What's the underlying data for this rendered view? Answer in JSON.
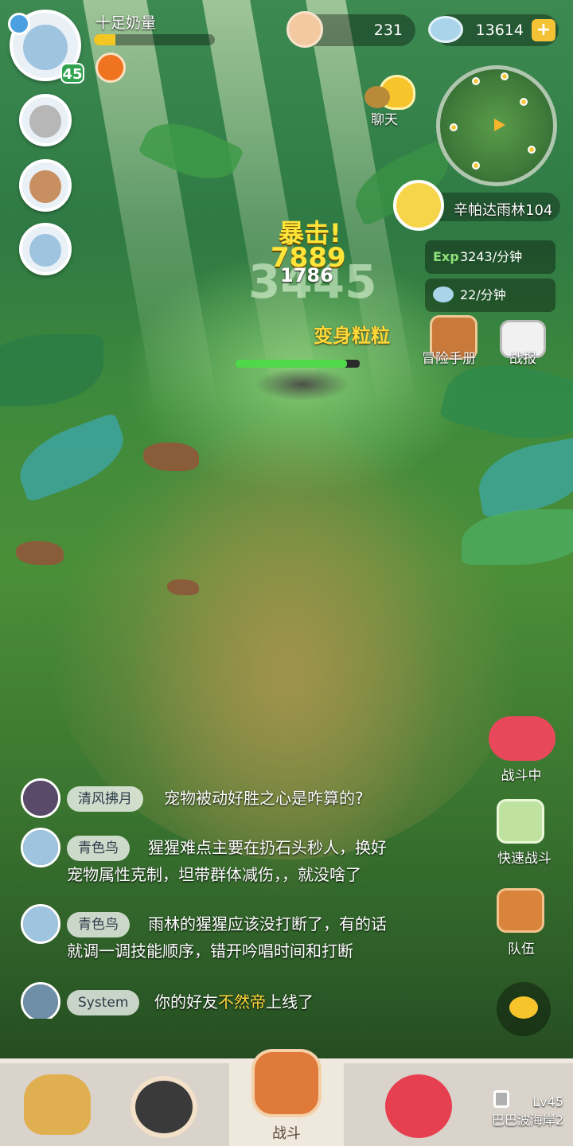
{
  "player": {
    "name": "十足奶量",
    "level": "45",
    "exp_fraction": 0.18
  },
  "currencies": {
    "shell_value": "231",
    "gem_value": "13614",
    "add_symbol": "+"
  },
  "chat_button_label": "聊天",
  "zone": {
    "name": "辛帕达雨林104",
    "exp_prefix": "Exp",
    "exp_rate": "3243/分钟",
    "gem_rate": "22/分钟"
  },
  "battle_text": {
    "crit_label": "暴击!",
    "crit_value": "7889",
    "damage_white": "1786",
    "damage_big": "3445",
    "enemy_name": "变身粒粒"
  },
  "side_buttons": {
    "manual": "冒险手册",
    "report": "战报",
    "fighting": "战斗中",
    "quick_battle": "快速战斗",
    "team": "队伍"
  },
  "chat": {
    "messages": [
      {
        "name": "清风拂月",
        "text": "宠物被动好胜之心是咋算的?"
      },
      {
        "name": "青色鸟",
        "text1": "猩猩难点主要在扔石头秒人，换好",
        "text2": "宠物属性克制，坦带群体减伤，，就没啥了"
      },
      {
        "name": "青色鸟",
        "text1": "雨林的猩猩应该没打断了，有的话",
        "text2": "就调一调技能顺序，错开吟唱时间和打断"
      },
      {
        "name": "System",
        "text_pre": "你的好友",
        "text_hl": "不然帝",
        "text_post": "上线了"
      }
    ]
  },
  "bottom_nav": {
    "battle": "战斗",
    "locked_level": "Lv45",
    "locked_place": "巴巴波海岸2"
  },
  "colors": {
    "accent_yellow": "#ffd83a",
    "level_green": "#2fa34f",
    "nav_bg": "#d9d3cb"
  }
}
